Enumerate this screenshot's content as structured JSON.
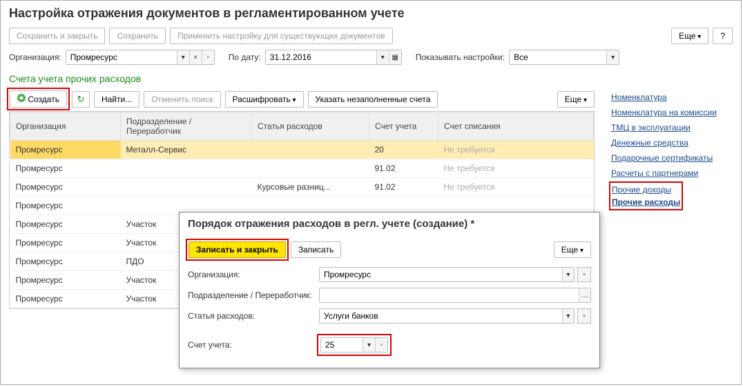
{
  "title": "Настройка отражения документов в регламентированном учете",
  "top_buttons": {
    "save_close": "Сохранить и закрыть",
    "save": "Сохранить",
    "apply": "Применить настройку для существующих документов",
    "more": "Еще",
    "help": "?"
  },
  "filters": {
    "org_label": "Организация:",
    "org_value": "Промресурс",
    "date_label": "По дату:",
    "date_value": "31.12.2016",
    "show_label": "Показывать настройки:",
    "show_value": "Все"
  },
  "section_title": "Счета учета прочих расходов",
  "grid_buttons": {
    "create": "Создать",
    "find": "Найти...",
    "cancel_search": "Отменить поиск",
    "decode": "Расшифровать",
    "show_empty": "Указать незаполненные счета",
    "more": "Еще"
  },
  "columns": {
    "org": "Организация",
    "dept": "Подразделение / Переработчик",
    "article": "Статья расходов",
    "account": "Счет учета",
    "writeoff": "Счет списания"
  },
  "rows": [
    {
      "org": "Промресурс",
      "dept": "Металл-Сервис",
      "article": "",
      "account": "20",
      "writeoff": "Не требуется",
      "sel": true
    },
    {
      "org": "Промресурс",
      "dept": "",
      "article": "",
      "account": "91.02",
      "writeoff": "Не требуется"
    },
    {
      "org": "Промресурс",
      "dept": "",
      "article": "Курсовые разниц...",
      "account": "91.02",
      "writeoff": "Не требуется"
    },
    {
      "org": "Промресурс",
      "dept": "",
      "article": "",
      "account": "",
      "writeoff": ""
    },
    {
      "org": "Промресурс",
      "dept": "Участок",
      "article": "",
      "account": "",
      "writeoff": ""
    },
    {
      "org": "Промресурс",
      "dept": "Участок",
      "article": "",
      "account": "",
      "writeoff": ""
    },
    {
      "org": "Промресурс",
      "dept": "ПДО",
      "article": "",
      "account": "",
      "writeoff": ""
    },
    {
      "org": "Промресурс",
      "dept": "Участок",
      "article": "",
      "account": "",
      "writeoff": ""
    },
    {
      "org": "Промресурс",
      "dept": "Участок",
      "article": "",
      "account": "",
      "writeoff": ""
    }
  ],
  "side_links": [
    "Номенклатура",
    "Номенклатура на комиссии",
    "ТМЦ в эксплуатации",
    "Денежные средства",
    "Подарочные сертификаты",
    "Расчеты с партнерами",
    "Прочие доходы",
    "Прочие расходы"
  ],
  "dialog": {
    "title": "Порядок отражения расходов в регл. учете (создание) *",
    "write_close": "Записать и закрыть",
    "write": "Записать",
    "more": "Еще",
    "org_label": "Организация:",
    "org_value": "Промресурс",
    "dept_label": "Подразделение / Переработчик:",
    "dept_value": "",
    "article_label": "Статья расходов:",
    "article_value": "Услуги банков",
    "account_label": "Счет учета:",
    "account_value": "25"
  }
}
